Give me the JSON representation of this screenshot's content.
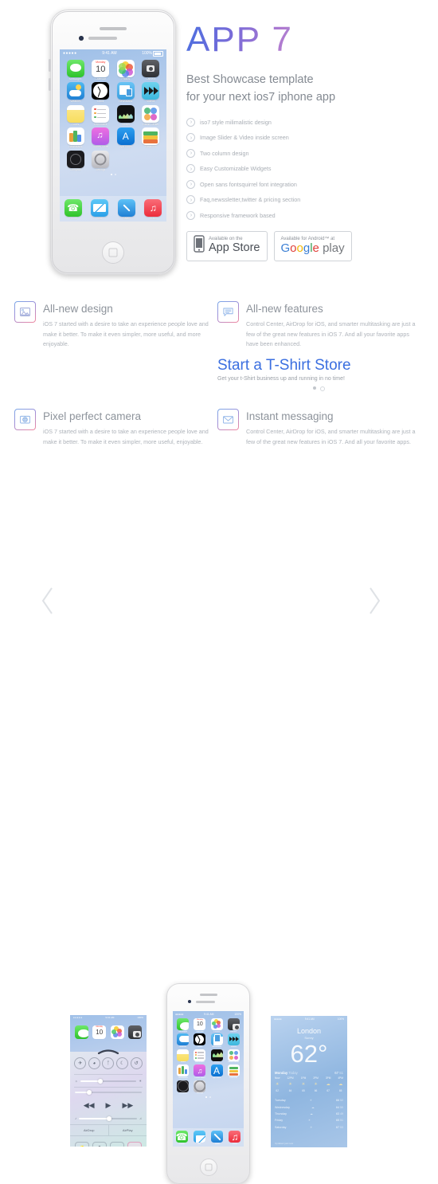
{
  "hero": {
    "logo": "APP 7",
    "tagline_line1": "Best Showcase template",
    "tagline_line2": "for your next ios7 iphone app",
    "features": [
      "iso7 style milimalistic design",
      "Image Slider & Video inside screen",
      "Two column design",
      "Easy Customizable Widgets",
      "Open sans fontsquirrel font integration",
      "Faq,newssletter,twitter & pricing section",
      "Responsive framework based"
    ],
    "stores": {
      "appstore_small": "Available on the",
      "appstore_big": "App Store",
      "googleplay_small": "Available for Android™ at",
      "googleplay_big": "Google",
      "googleplay_play": "play"
    }
  },
  "phone": {
    "status_carrier": "●●●●●",
    "status_time": "9:41 AM",
    "status_battery": "100%",
    "apps": [
      {
        "name": "Messages",
        "icon": "messages-icon"
      },
      {
        "name": "Calendar",
        "icon": "calendar-icon",
        "month": "Monday",
        "day": "10"
      },
      {
        "name": "Photos",
        "icon": "photos-icon"
      },
      {
        "name": "Camera",
        "icon": "camera-icon"
      },
      {
        "name": "Weather",
        "icon": "weather-icon"
      },
      {
        "name": "Clock",
        "icon": "clock-icon"
      },
      {
        "name": "Newsstand",
        "icon": "news-icon"
      },
      {
        "name": "Videos",
        "icon": "videos-icon"
      },
      {
        "name": "Notes",
        "icon": "notes-icon"
      },
      {
        "name": "Reminders",
        "icon": "reminders-icon"
      },
      {
        "name": "Stocks",
        "icon": "stocks-icon"
      },
      {
        "name": "Game Center",
        "icon": "gamecenter-icon"
      },
      {
        "name": "Newsstand",
        "icon": "newsstand-icon"
      },
      {
        "name": "iTunes Store",
        "icon": "itunes-icon"
      },
      {
        "name": "App Store",
        "icon": "appstore-icon"
      },
      {
        "name": "Passbook",
        "icon": "passbook-icon"
      },
      {
        "name": "Compass",
        "icon": "compass-icon"
      },
      {
        "name": "Settings",
        "icon": "settings-icon"
      }
    ],
    "dock": [
      {
        "name": "Phone",
        "icon": "phone-icon"
      },
      {
        "name": "Mail",
        "icon": "mail-icon"
      },
      {
        "name": "Safari",
        "icon": "safari-icon"
      },
      {
        "name": "Music",
        "icon": "music-icon"
      }
    ],
    "page_dots": 2,
    "active_dot": 0
  },
  "features_section": {
    "items": [
      {
        "title": "All-new design",
        "icon": "photo-image-icon",
        "desc": "iOS 7 started with a desire to take an experience people love and make it better. To make it even simpler, more useful, and more enjoyable."
      },
      {
        "title": "All-new features",
        "icon": "chat-bubble-icon",
        "desc": "Control Center, AirDrop for iOS, and smarter multitasking are just a few of the great new features in iOS 7. And all your favorite apps have been enhanced."
      },
      {
        "title": "Pixel perfect camera",
        "icon": "camera-lens-icon",
        "desc": "iOS 7 started with a desire to take an experience people love and make it better. To make it even simpler, more useful, enjoyable."
      },
      {
        "title": "Instant messaging",
        "icon": "envelope-icon",
        "desc": "Control Center, AirDrop for iOS, and smarter multitasking are just a few of the great new features in iOS 7. And all your favorite apps."
      }
    ],
    "promo": {
      "title": "Start a T-Shirt Store",
      "subtitle": "Get your t-Shirt business up and running in no time!",
      "dots": 2,
      "active_dot": 0
    }
  },
  "slider": {
    "prev_icon": "chevron-left-icon",
    "next_icon": "chevron-right-icon",
    "control_center": {
      "airplay_label": "AirDrop",
      "airplay_label2": "AirPlay",
      "tools": [
        "flashlight-icon",
        "timer-icon",
        "calculator-icon",
        "camera-icon"
      ],
      "toggles": [
        "airplane-icon",
        "wifi-icon",
        "bluetooth-icon",
        "donotdisturb-icon",
        "rotationlock-icon"
      ]
    },
    "weather": {
      "status_time": "9:41 AM",
      "status_battery": "100%",
      "city": "London",
      "condition": "Sunny",
      "temperature": "62°",
      "today_label": "Monday",
      "today_sub": "Today",
      "hi": "67",
      "lo": "51",
      "hours": [
        {
          "time": "Now",
          "temp": "62"
        },
        {
          "time": "12PM",
          "temp": "64"
        },
        {
          "time": "1PM",
          "temp": "65"
        },
        {
          "time": "2PM",
          "temp": "66"
        },
        {
          "time": "3PM",
          "temp": "67"
        },
        {
          "time": "4PM",
          "temp": "65"
        }
      ],
      "days": [
        {
          "day": "Tuesday",
          "icon": "☀",
          "hi": "66",
          "lo": "52"
        },
        {
          "day": "Wednesday",
          "icon": "☁",
          "hi": "64",
          "lo": "50"
        },
        {
          "day": "Thursday",
          "icon": "☁",
          "hi": "63",
          "lo": "49"
        },
        {
          "day": "Friday",
          "icon": "☀",
          "hi": "65",
          "lo": "51"
        },
        {
          "day": "Saturday",
          "icon": "☀",
          "hi": "67",
          "lo": "53"
        }
      ],
      "footer": "Updated just now"
    }
  },
  "colors": {
    "accent_blue": "#3b6fe0",
    "text_gray": "#8d939b",
    "muted_gray": "#aeb3ba",
    "icon_gradient_start": "#7aa8e8",
    "icon_gradient_end": "#f2889f"
  }
}
